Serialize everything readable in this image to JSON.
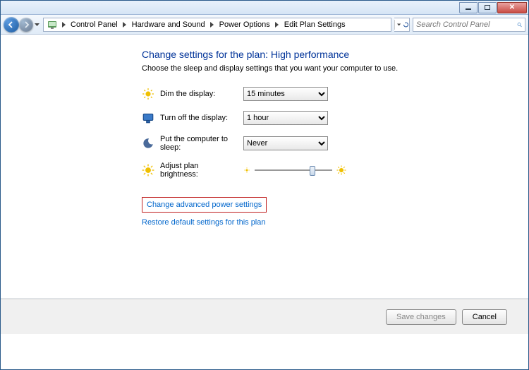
{
  "breadcrumb": {
    "items": [
      "Control Panel",
      "Hardware and Sound",
      "Power Options",
      "Edit Plan Settings"
    ]
  },
  "search": {
    "placeholder": "Search Control Panel"
  },
  "page": {
    "heading": "Change settings for the plan: High performance",
    "subtext": "Choose the sleep and display settings that you want your computer to use."
  },
  "rows": {
    "dim": {
      "label": "Dim the display:",
      "value": "15 minutes"
    },
    "off": {
      "label": "Turn off the display:",
      "value": "1 hour"
    },
    "sleep": {
      "label": "Put the computer to sleep:",
      "value": "Never"
    },
    "brightness": {
      "label": "Adjust plan brightness:"
    }
  },
  "links": {
    "advanced": "Change advanced power settings",
    "restore": "Restore default settings for this plan"
  },
  "buttons": {
    "save": "Save changes",
    "cancel": "Cancel"
  }
}
